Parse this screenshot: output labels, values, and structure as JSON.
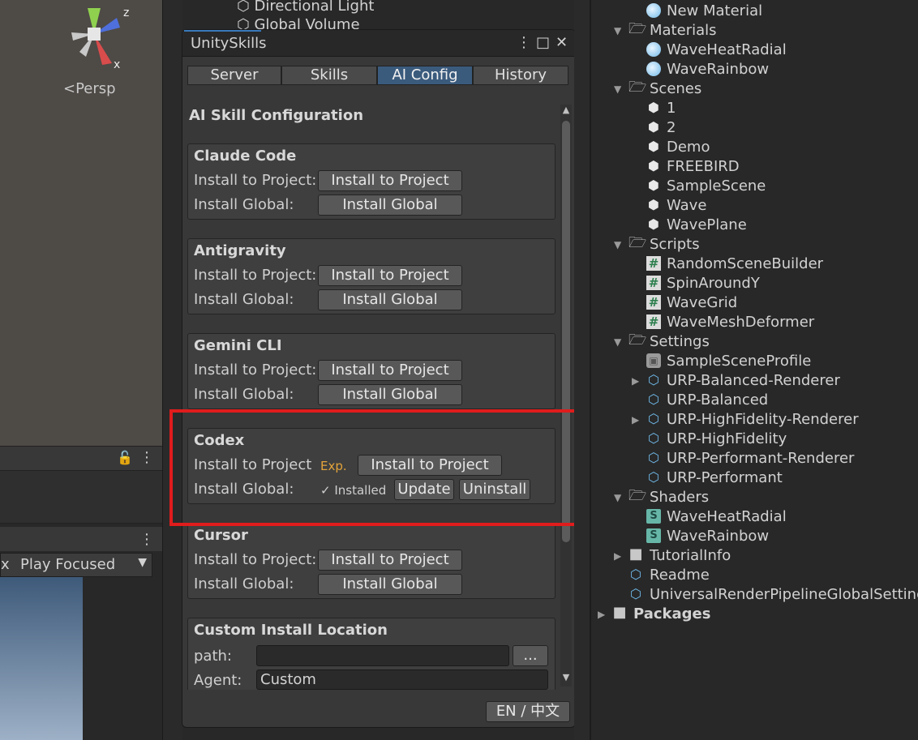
{
  "scene": {
    "persp_label": "Persp",
    "gizmo_z": "z",
    "gizmo_x": "x"
  },
  "hierarchy_top": [
    {
      "label": "Directional Light"
    },
    {
      "label": "Global Volume"
    }
  ],
  "game_view": {
    "play_mode": "Play Focused",
    "dropdown_arrow": "▼",
    "left_stub": "x"
  },
  "window": {
    "title": "UnitySkills",
    "menu_glyph": "⋮",
    "maximize_glyph": "□",
    "close_glyph": "✕",
    "tabs": [
      {
        "label": "Server"
      },
      {
        "label": "Skills"
      },
      {
        "label": "AI Config"
      },
      {
        "label": "History"
      }
    ],
    "section_title": "AI Skill Configuration",
    "cards": [
      {
        "title": "Claude Code",
        "project_label": "Install to Project:",
        "project_btn": "Install to Project",
        "global_label": "Install Global:",
        "global_btn": "Install Global"
      },
      {
        "title": "Antigravity",
        "project_label": "Install to Project:",
        "project_btn": "Install to Project",
        "global_label": "Install Global:",
        "global_btn": "Install Global"
      },
      {
        "title": "Gemini CLI",
        "project_label": "Install to Project:",
        "project_btn": "Install to Project",
        "global_label": "Install Global:",
        "global_btn": "Install Global"
      },
      {
        "title": "Codex",
        "project_label": "Install to Project",
        "exp_badge": "Exp.",
        "project_btn": "Install to Project",
        "global_label": "Install Global:",
        "installed_status": "✓ Installed",
        "update_btn": "Update",
        "uninstall_btn": "Uninstall"
      },
      {
        "title": "Cursor",
        "project_label": "Install to Project:",
        "project_btn": "Install to Project",
        "global_label": "Install Global:",
        "global_btn": "Install Global"
      }
    ],
    "custom": {
      "title": "Custom Install Location",
      "path_label": "path:",
      "path_value": "",
      "browse_btn": "...",
      "agent_label": "Agent:",
      "agent_value": "Custom"
    },
    "scroll_up": "▲",
    "scroll_down": "▼",
    "lang_button": "EN / 中文"
  },
  "project": {
    "items": [
      {
        "label": "New Material",
        "icon": "material-icon"
      },
      {
        "label": "Materials",
        "icon": "folder-open-icon"
      },
      {
        "label": "WaveHeatRadial",
        "icon": "material-icon"
      },
      {
        "label": "WaveRainbow",
        "icon": "material-icon"
      },
      {
        "label": "Scenes",
        "icon": "folder-open-icon"
      },
      {
        "label": "1",
        "icon": "scene-icon"
      },
      {
        "label": "2",
        "icon": "scene-icon"
      },
      {
        "label": "Demo",
        "icon": "scene-icon"
      },
      {
        "label": "FREEBIRD",
        "icon": "scene-icon"
      },
      {
        "label": "SampleScene",
        "icon": "scene-icon"
      },
      {
        "label": "Wave",
        "icon": "scene-icon"
      },
      {
        "label": "WavePlane",
        "icon": "scene-icon"
      },
      {
        "label": "Scripts",
        "icon": "folder-open-icon"
      },
      {
        "label": "RandomSceneBuilder",
        "icon": "script-icon"
      },
      {
        "label": "SpinAroundY",
        "icon": "script-icon"
      },
      {
        "label": "WaveGrid",
        "icon": "script-icon"
      },
      {
        "label": "WaveMeshDeformer",
        "icon": "script-icon"
      },
      {
        "label": "Settings",
        "icon": "folder-open-icon"
      },
      {
        "label": "SampleSceneProfile",
        "icon": "profile-icon"
      },
      {
        "label": "URP-Balanced-Renderer",
        "icon": "asset-icon"
      },
      {
        "label": "URP-Balanced",
        "icon": "asset-icon"
      },
      {
        "label": "URP-HighFidelity-Renderer",
        "icon": "asset-icon"
      },
      {
        "label": "URP-HighFidelity",
        "icon": "asset-icon"
      },
      {
        "label": "URP-Performant-Renderer",
        "icon": "asset-icon"
      },
      {
        "label": "URP-Performant",
        "icon": "asset-icon"
      },
      {
        "label": "Shaders",
        "icon": "folder-open-icon"
      },
      {
        "label": "WaveHeatRadial",
        "icon": "shader-icon"
      },
      {
        "label": "WaveRainbow",
        "icon": "shader-icon"
      },
      {
        "label": "TutorialInfo",
        "icon": "folder-icon"
      },
      {
        "label": "Readme",
        "icon": "asset-icon"
      },
      {
        "label": "UniversalRenderPipelineGlobalSettings",
        "icon": "asset-icon"
      },
      {
        "label": "Packages",
        "icon": "folder-icon"
      }
    ]
  }
}
